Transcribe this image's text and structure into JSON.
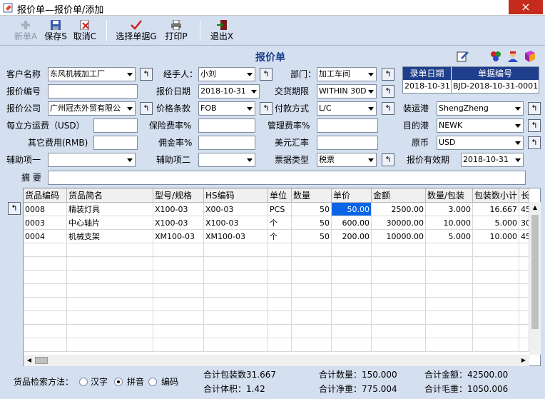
{
  "window": {
    "title": "报价单—报价单/添加",
    "close": "×"
  },
  "toolbar": [
    {
      "label": "新单A",
      "icon": "plus-icon",
      "disabled": true
    },
    {
      "label": "保存S",
      "icon": "save-icon"
    },
    {
      "label": "取消C",
      "icon": "cancel-icon"
    },
    {
      "label": "选择单据G",
      "icon": "check-icon"
    },
    {
      "label": "打印P",
      "icon": "printer-icon"
    },
    {
      "label": "退出X",
      "icon": "exit-icon"
    }
  ],
  "form": {
    "title": "报价单",
    "labels": {
      "customer": "客户名称",
      "handler": "经手人：",
      "dept": "部门：",
      "quote_no": "报价编号",
      "quote_date": "报价日期",
      "delivery": "交货期限",
      "company": "报价公司",
      "price_terms": "价格条款",
      "payment": "付款方式",
      "ship_port": "装运港",
      "freight": "每立方运费（USD）",
      "insurance": "保险费率%",
      "mgmt_fee": "管理费率%",
      "dest_port": "目的港",
      "other_fee": "其它费用(RMB)",
      "commission": "佣金率%",
      "usd_rate": "美元汇率",
      "currency": "原币",
      "aux1": "辅助项一",
      "aux2": "辅助项二",
      "invoice_type": "票据类型",
      "validity": "报价有效期",
      "summary": "摘    要"
    },
    "values": {
      "customer": "东风机械加工厂",
      "handler": "小刘",
      "dept": "加工车间",
      "quote_no": "",
      "quote_date": "2018-10-31",
      "delivery": "WITHIN 30D.",
      "company": "广州冠杰外贸有限公",
      "price_terms": "FOB",
      "payment": "L/C",
      "ship_port": "ShengZheng",
      "freight": "",
      "insurance": "",
      "mgmt_fee": "",
      "dest_port": "NEWK",
      "other_fee": "",
      "commission": "",
      "usd_rate": "",
      "currency": "USD",
      "aux1": "",
      "aux2": "",
      "invoice_type": "税票",
      "validity": "2018-10-31",
      "summary": ""
    },
    "record": {
      "date_header": "录单日期",
      "no_header": "单据编号",
      "date": "2018-10-31",
      "no": "BJD-2018-10-31-0001"
    }
  },
  "grid": {
    "columns": [
      "货品编码",
      "货品简名",
      "型号/规格",
      "HS编码",
      "单位",
      "数量",
      "单价",
      "金额",
      "数量/包装",
      "包装数小计",
      "长"
    ],
    "rows": [
      [
        "0008",
        "精装灯具",
        "X100-03",
        "X00-03",
        "PCS",
        "50",
        "50.00",
        "2500.00",
        "3.000",
        "16.667",
        "45"
      ],
      [
        "0003",
        "中心轴片",
        "X100-03",
        "X100-03",
        "个",
        "50",
        "600.00",
        "30000.00",
        "10.000",
        "5.000",
        "30"
      ],
      [
        "0004",
        "机械支架",
        "XM100-03",
        "XM100-03",
        "个",
        "50",
        "200.00",
        "10000.00",
        "5.000",
        "10.000",
        "45"
      ]
    ]
  },
  "footer": {
    "search_label": "货品检索方法：",
    "search_options": [
      "汉字",
      "拼音",
      "编码"
    ],
    "search_selected": "拼音",
    "pack_total": "合计包装数31.667",
    "volume_total": "合计体积：1.42",
    "qty_total": "合计数量：150.000",
    "net_total": "合计净重：775.004",
    "amount_total": "合计金额：42500.00",
    "gross_total": "合计毛重：1050.006"
  },
  "colors": {
    "accent": "#1f3f8c",
    "selection": "#0a64e6",
    "bg": "#d4dff0"
  }
}
